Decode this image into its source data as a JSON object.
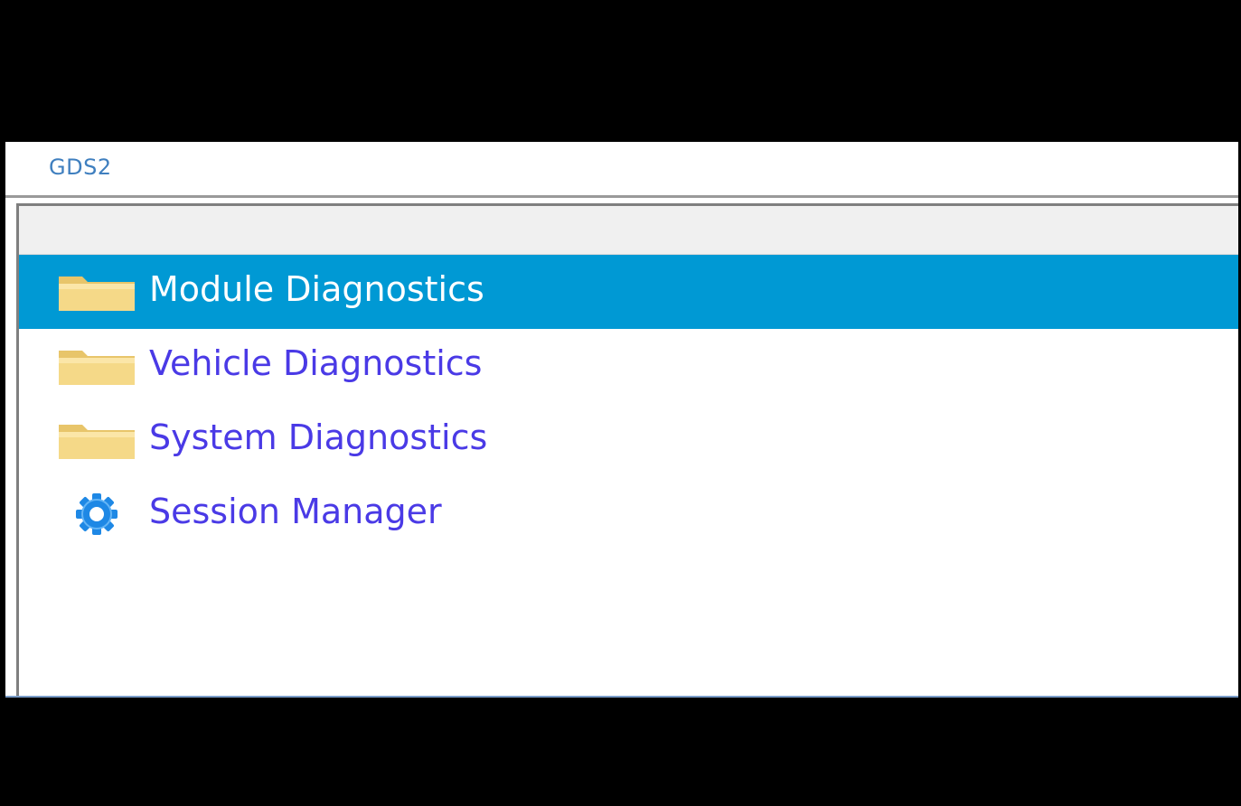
{
  "window": {
    "title": "GDS2"
  },
  "search": {
    "value": "",
    "placeholder": ""
  },
  "menu": {
    "items": [
      {
        "label": "Module Diagnostics",
        "icon": "folder-icon",
        "selected": true
      },
      {
        "label": "Vehicle Diagnostics",
        "icon": "folder-icon",
        "selected": false
      },
      {
        "label": "System Diagnostics",
        "icon": "folder-icon",
        "selected": false
      },
      {
        "label": "Session Manager",
        "icon": "gear-icon",
        "selected": false
      }
    ]
  },
  "colors": {
    "selection": "#0099d4",
    "item_text": "#4a3ae6",
    "title_text": "#3f7fbf",
    "folder": "#f0d080",
    "gear": "#1e88e5"
  }
}
